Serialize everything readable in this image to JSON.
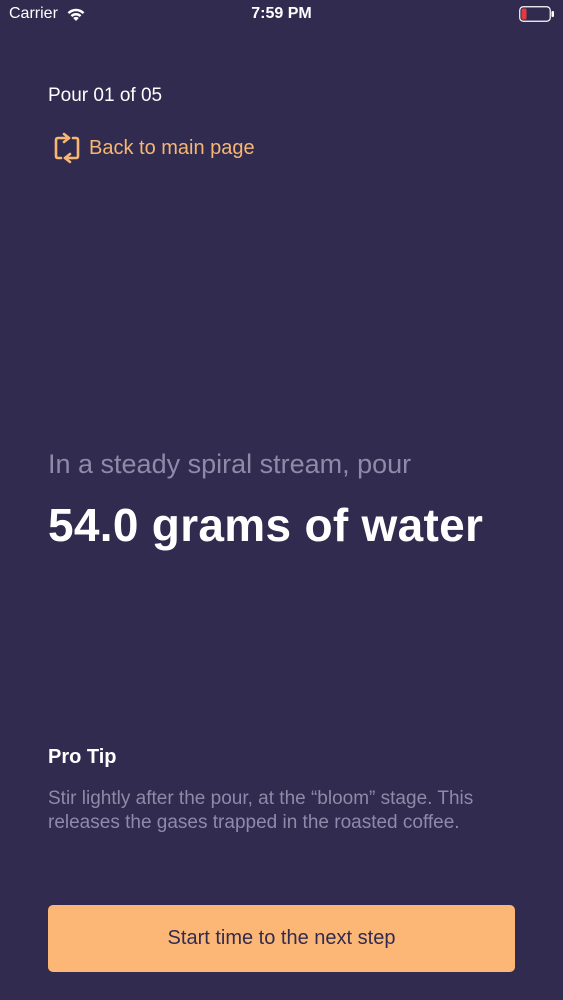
{
  "status_bar": {
    "carrier": "Carrier",
    "time": "7:59 PM",
    "battery_color": "#e5393f"
  },
  "header": {
    "pour_counter": "Pour 01 of 05",
    "back_label": "Back to main page",
    "back_icon": "repeat-arrows-icon"
  },
  "step": {
    "instruction": "In a steady spiral stream, pour",
    "amount": "54.0 grams of water"
  },
  "tip": {
    "title": "Pro Tip",
    "body": "Stir lightly after the pour, at the “bloom” stage. This releases the gases trapped in the roasted coffee."
  },
  "actions": {
    "next_label": "Start time to the next step"
  },
  "colors": {
    "background": "#302b4f",
    "accent": "#fcb777",
    "muted_text": "#8f8aa8"
  }
}
